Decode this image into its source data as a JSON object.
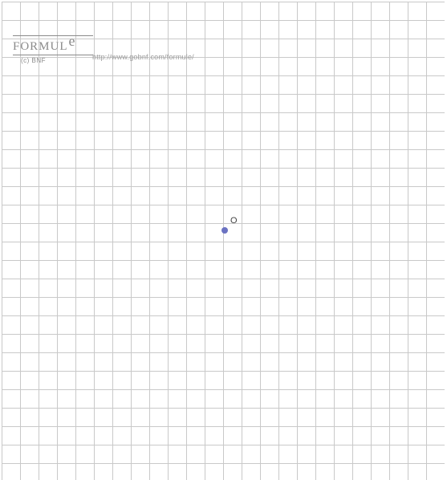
{
  "brand": {
    "name_prefix": "FORMUL",
    "name_suffix": "e",
    "copyright": "(c) BNF",
    "url": "http://www.gobnf.com/formule/"
  },
  "origin": {
    "label": "O"
  },
  "chart_data": {
    "type": "scatter",
    "title": "",
    "xlabel": "",
    "ylabel": "",
    "grid": true,
    "xlim": [
      -12,
      12
    ],
    "ylim": [
      -13,
      13
    ],
    "series": [
      {
        "name": "origin",
        "points": [
          {
            "x": 0,
            "y": 0,
            "label": "O"
          }
        ]
      }
    ],
    "annotations": [
      {
        "text": "O",
        "x": 0,
        "y": 0
      }
    ]
  }
}
